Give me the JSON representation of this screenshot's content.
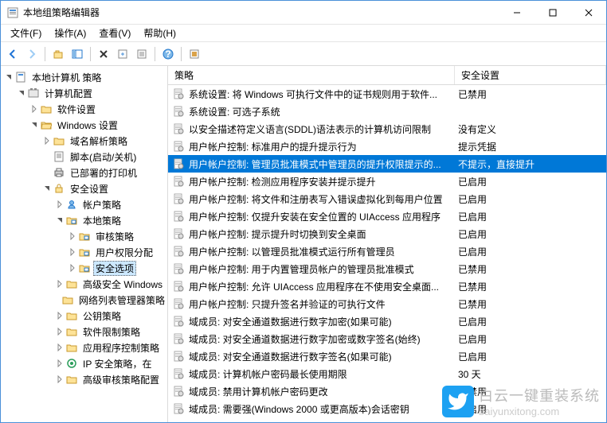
{
  "window": {
    "title": "本地组策略编辑器"
  },
  "menu": {
    "file": "文件(F)",
    "action": "操作(A)",
    "view": "查看(V)",
    "help": "帮助(H)"
  },
  "tree": {
    "root": "本地计算机 策略",
    "items": [
      {
        "label": "计算机配置",
        "indent": 1,
        "open": true,
        "icon": "config"
      },
      {
        "label": "软件设置",
        "indent": 2,
        "open": false,
        "icon": "folder"
      },
      {
        "label": "Windows 设置",
        "indent": 2,
        "open": true,
        "icon": "folder-open"
      },
      {
        "label": "域名解析策略",
        "indent": 3,
        "open": false,
        "icon": "folder"
      },
      {
        "label": "脚本(启动/关机)",
        "indent": 3,
        "open": false,
        "icon": "script",
        "leaf": true
      },
      {
        "label": "已部署的打印机",
        "indent": 3,
        "open": false,
        "icon": "printer",
        "leaf": true
      },
      {
        "label": "安全设置",
        "indent": 3,
        "open": true,
        "icon": "lock"
      },
      {
        "label": "帐户策略",
        "indent": 4,
        "open": false,
        "icon": "user"
      },
      {
        "label": "本地策略",
        "indent": 4,
        "open": true,
        "icon": "folder-pol"
      },
      {
        "label": "审核策略",
        "indent": 5,
        "open": false,
        "icon": "folder-pol"
      },
      {
        "label": "用户权限分配",
        "indent": 5,
        "open": false,
        "icon": "folder-pol"
      },
      {
        "label": "安全选项",
        "indent": 5,
        "open": false,
        "icon": "folder-pol",
        "selected": true
      },
      {
        "label": "高级安全 Windows",
        "indent": 4,
        "open": false,
        "icon": "folder"
      },
      {
        "label": "网络列表管理器策略",
        "indent": 4,
        "open": false,
        "icon": "folder",
        "leaf": true
      },
      {
        "label": "公钥策略",
        "indent": 4,
        "open": false,
        "icon": "folder"
      },
      {
        "label": "软件限制策略",
        "indent": 4,
        "open": false,
        "icon": "folder"
      },
      {
        "label": "应用程序控制策略",
        "indent": 4,
        "open": false,
        "icon": "folder"
      },
      {
        "label": "IP 安全策略，在",
        "indent": 4,
        "open": false,
        "icon": "ipsec"
      },
      {
        "label": "高级审核策略配置",
        "indent": 4,
        "open": false,
        "icon": "folder"
      }
    ]
  },
  "list": {
    "header_policy": "策略",
    "header_setting": "安全设置",
    "rows": [
      {
        "name": "系统设置: 将 Windows 可执行文件中的证书规则用于软件...",
        "setting": "已禁用"
      },
      {
        "name": "系统设置: 可选子系统",
        "setting": ""
      },
      {
        "name": "以安全描述符定义语言(SDDL)语法表示的计算机访问限制",
        "setting": "没有定义"
      },
      {
        "name": "用户帐户控制: 标准用户的提升提示行为",
        "setting": "提示凭据"
      },
      {
        "name": "用户帐户控制: 管理员批准模式中管理员的提升权限提示的...",
        "setting": "不提示，直接提升",
        "selected": true
      },
      {
        "name": "用户帐户控制: 检测应用程序安装并提示提升",
        "setting": "已启用"
      },
      {
        "name": "用户帐户控制: 将文件和注册表写入错误虚拟化到每用户位置",
        "setting": "已启用"
      },
      {
        "name": "用户帐户控制: 仅提升安装在安全位置的 UIAccess 应用程序",
        "setting": "已启用"
      },
      {
        "name": "用户帐户控制: 提示提升时切换到安全桌面",
        "setting": "已启用"
      },
      {
        "name": "用户帐户控制: 以管理员批准模式运行所有管理员",
        "setting": "已启用"
      },
      {
        "name": "用户帐户控制: 用于内置管理员帐户的管理员批准模式",
        "setting": "已禁用"
      },
      {
        "name": "用户帐户控制: 允许 UIAccess 应用程序在不使用安全桌面...",
        "setting": "已禁用"
      },
      {
        "name": "用户帐户控制: 只提升签名并验证的可执行文件",
        "setting": "已禁用"
      },
      {
        "name": "域成员: 对安全通道数据进行数字加密(如果可能)",
        "setting": "已启用"
      },
      {
        "name": "域成员: 对安全通道数据进行数字加密或数字签名(始终)",
        "setting": "已启用"
      },
      {
        "name": "域成员: 对安全通道数据进行数字签名(如果可能)",
        "setting": "已启用"
      },
      {
        "name": "域成员: 计算机帐户密码最长使用期限",
        "setting": "30 天"
      },
      {
        "name": "域成员: 禁用计算机帐户密码更改",
        "setting": "已禁用"
      },
      {
        "name": "域成员: 需要强(Windows 2000 或更高版本)会话密钥",
        "setting": "已启用"
      }
    ]
  },
  "watermark": {
    "cn": "白云一键重装系统",
    "en": "baiyunxitong.com"
  }
}
